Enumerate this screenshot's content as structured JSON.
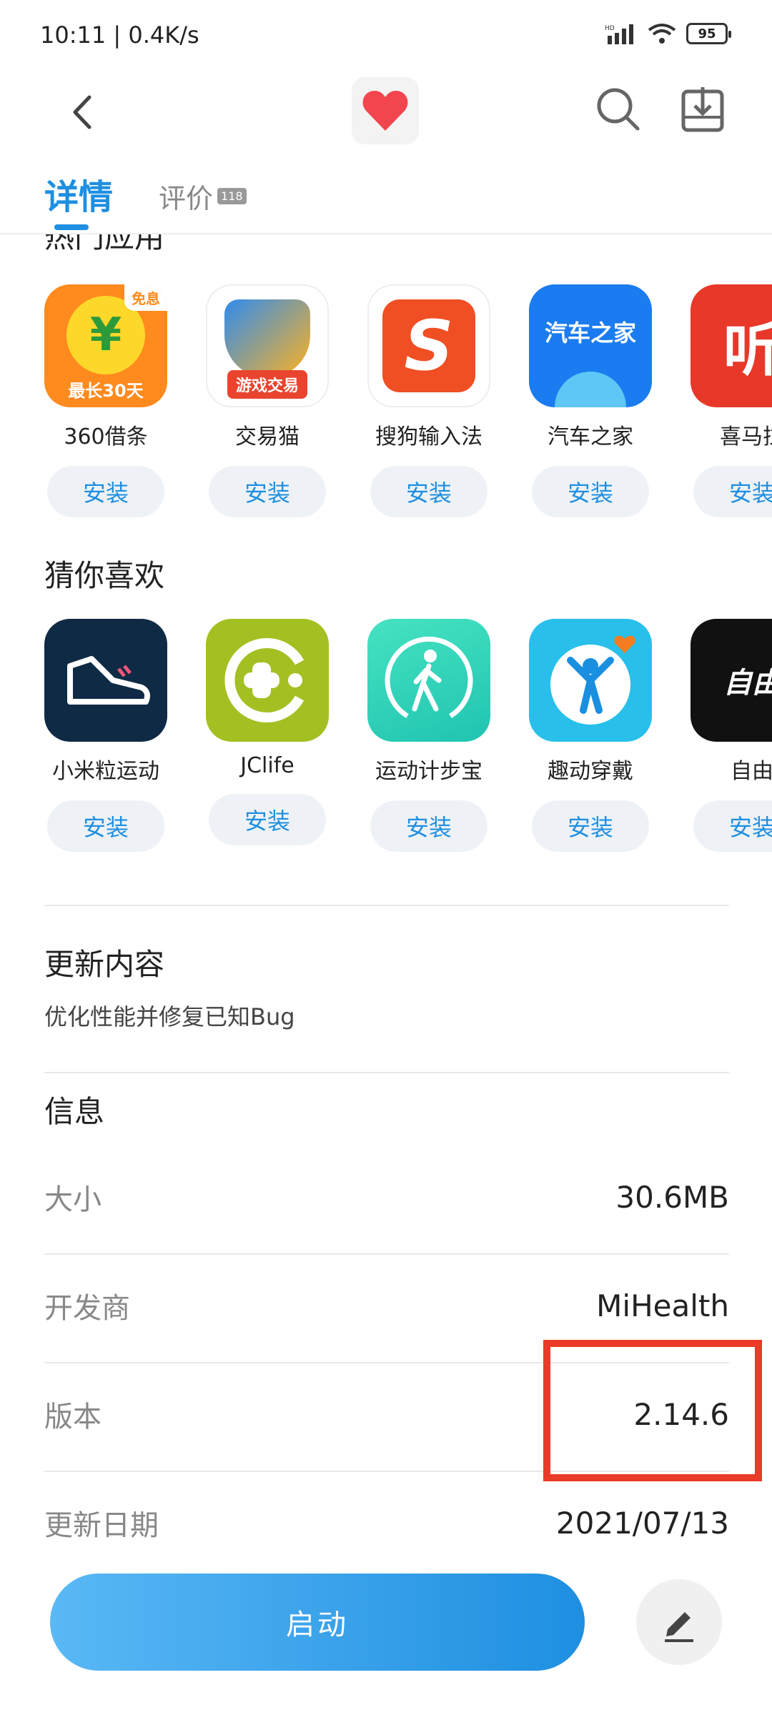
{
  "status": {
    "time": "10:11 | 0.4K/s",
    "battery": "95"
  },
  "tabs": [
    {
      "label": "详情"
    },
    {
      "label": "评价",
      "badge": "118"
    }
  ],
  "hot_apps": {
    "title": "热门应用",
    "items": [
      {
        "name": "360借条",
        "install": "安装",
        "icon_text": "¥",
        "icon_sub": "最长30天",
        "icon_corner": "免息"
      },
      {
        "name": "交易猫",
        "install": "安装",
        "icon_text": "游戏交易"
      },
      {
        "name": "搜狗输入法",
        "install": "安装",
        "icon_text": "S"
      },
      {
        "name": "汽车之家",
        "install": "安装",
        "icon_text": "汽车之家"
      },
      {
        "name": "喜马拉",
        "install": "安装",
        "icon_text": "听"
      }
    ]
  },
  "recommend": {
    "title": "猜你喜欢",
    "items": [
      {
        "name": "小米粒运动",
        "install": "安装"
      },
      {
        "name": "JClife",
        "install": "安装"
      },
      {
        "name": "运动计步宝",
        "install": "安装"
      },
      {
        "name": "趣动穿戴",
        "install": "安装"
      },
      {
        "name": "自由",
        "install": "安装",
        "icon_text": "自由"
      }
    ]
  },
  "update": {
    "title": "更新内容",
    "text": "优化性能并修复已知Bug"
  },
  "info": {
    "title": "信息",
    "rows": [
      {
        "label": "大小",
        "value": "30.6MB"
      },
      {
        "label": "开发商",
        "value": "MiHealth"
      },
      {
        "label": "版本",
        "value": "2.14.6"
      },
      {
        "label": "更新日期",
        "value": "2021/07/13"
      }
    ]
  },
  "bottom": {
    "launch": "启动"
  },
  "colors": {
    "accent": "#1e8fe1",
    "highlight": "#e93b28"
  }
}
